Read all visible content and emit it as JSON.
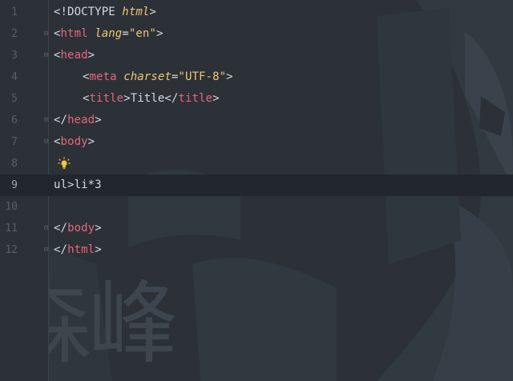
{
  "editor": {
    "language": "HTML",
    "active_line": 9,
    "colors": {
      "background": "#2b3137",
      "active_line": "#21272c",
      "tag": "#e8667a",
      "attribute": "#f0c674",
      "string": "#f0c674",
      "text": "#d7dae0",
      "line_number": "#56606a"
    },
    "lines": [
      {
        "num": "1",
        "t": [
          "<!DOCTYPE ",
          "html",
          ">"
        ]
      },
      {
        "num": "2",
        "t": [
          "<",
          "html",
          " ",
          "lang",
          "=",
          "\"en\"",
          ">"
        ]
      },
      {
        "num": "3",
        "t": [
          "<",
          "head",
          ">"
        ]
      },
      {
        "num": "4",
        "t": [
          "<",
          "meta",
          " ",
          "charset",
          "=",
          "\"UTF-8\"",
          ">"
        ]
      },
      {
        "num": "5",
        "t": [
          "<",
          "title",
          ">",
          "Title",
          "</",
          "title",
          ">"
        ]
      },
      {
        "num": "6",
        "t": [
          "</",
          "head",
          ">"
        ]
      },
      {
        "num": "7",
        "t": [
          "<",
          "body",
          ">"
        ]
      },
      {
        "num": "8",
        "icon": "lightbulb-icon"
      },
      {
        "num": "9",
        "t": [
          "ul>li*3"
        ]
      },
      {
        "num": "10"
      },
      {
        "num": "11",
        "t": [
          "</",
          "body",
          ">"
        ]
      },
      {
        "num": "12",
        "t": [
          "</",
          "html",
          ">"
        ]
      }
    ]
  },
  "watermark": {
    "text": "森峰",
    "icon": "figure-silhouette-icon"
  }
}
